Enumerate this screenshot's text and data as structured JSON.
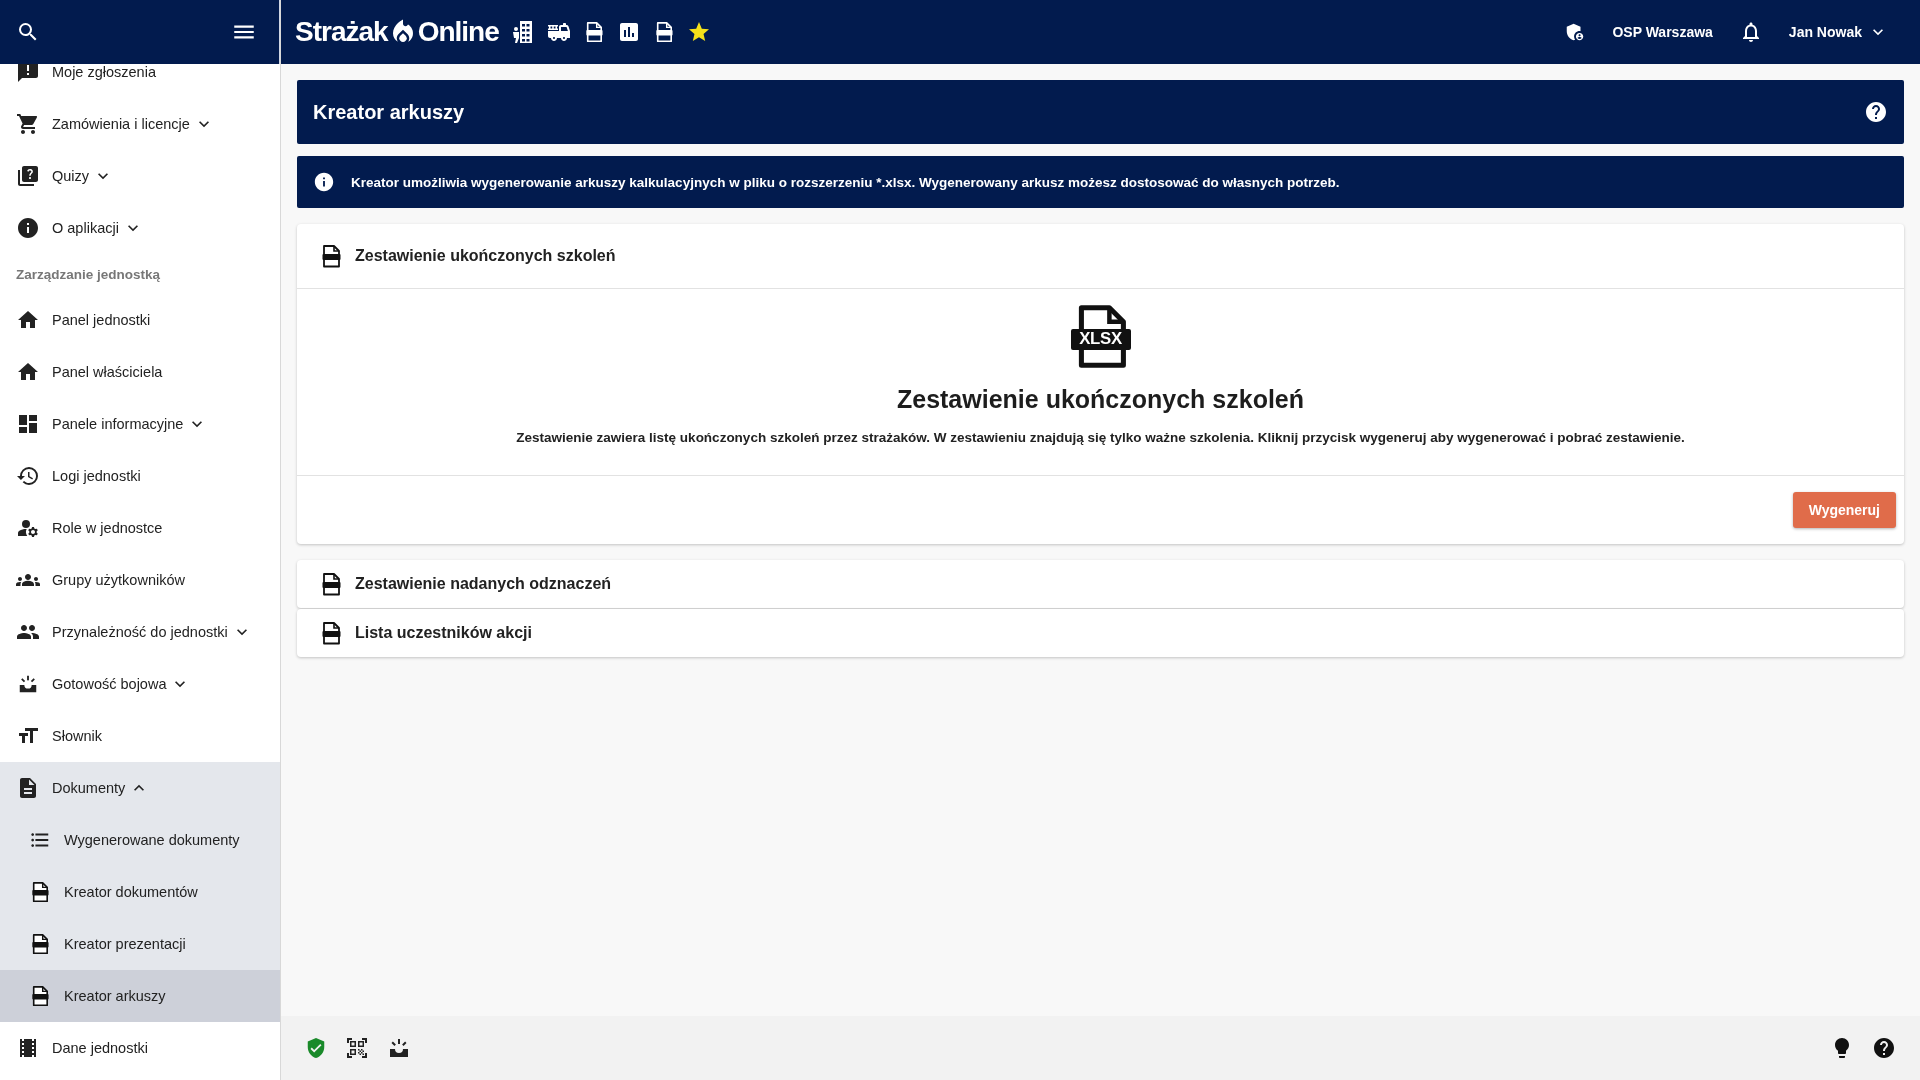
{
  "header": {
    "logo": [
      "Strażak",
      "Online"
    ],
    "unit": "OSP Warszawa",
    "user": "Jan Nowak"
  },
  "sidebar": {
    "items": [
      {
        "kind": "item",
        "label": "Moje zgłoszenia"
      },
      {
        "kind": "item",
        "label": "Zamówienia i licencje",
        "expanded": false
      },
      {
        "kind": "item",
        "label": "Quizy",
        "expanded": false
      },
      {
        "kind": "item",
        "label": "O aplikacji",
        "expanded": false
      },
      {
        "kind": "section",
        "label": "Zarządzanie jednostką"
      },
      {
        "kind": "item",
        "label": "Panel jednostki"
      },
      {
        "kind": "item",
        "label": "Panel właściciela"
      },
      {
        "kind": "item",
        "label": "Panele informacyjne",
        "expanded": false
      },
      {
        "kind": "item",
        "label": "Logi jednostki"
      },
      {
        "kind": "item",
        "label": "Role w jednostce"
      },
      {
        "kind": "item",
        "label": "Grupy użytkowników"
      },
      {
        "kind": "item",
        "label": "Przynależność do jednostki",
        "expanded": false
      },
      {
        "kind": "item",
        "label": "Gotowość bojowa",
        "expanded": false
      },
      {
        "kind": "item",
        "label": "Słownik"
      },
      {
        "kind": "item",
        "label": "Dokumenty",
        "expanded": true,
        "children": [
          {
            "label": "Wygenerowane dokumenty",
            "selected": false
          },
          {
            "label": "Kreator dokumentów",
            "kind": "file",
            "selected": false
          },
          {
            "label": "Kreator prezentacji",
            "kind": "file",
            "selected": false
          },
          {
            "label": "Kreator arkuszy",
            "kind": "file",
            "selected": true
          }
        ]
      },
      {
        "kind": "item",
        "label": "Dane jednostki"
      }
    ]
  },
  "page": {
    "title": "Kreator arkuszy",
    "info": "Kreator umożliwia wygenerowanie arkuszy kalkulacyjnych w pliku o rozszerzeniu *.xlsx. Wygenerowany arkusz możesz dostosować do własnych potrzeb.",
    "sheets": [
      {
        "title": "Zestawienie ukończonych szkoleń",
        "expanded": true,
        "big_file_label": "XLSX",
        "heading": "Zestawienie ukończonych szkoleń",
        "description": "Zestawienie zawiera listę ukończonych szkoleń przez strażaków. W zestawieniu znajdują się tylko ważne szkolenia. Kliknij przycisk wygeneruj aby wygenerować i pobrać zestawienie.",
        "button": "Wygeneruj"
      },
      {
        "title": "Zestawienie nadanych odznaczeń",
        "expanded": false
      },
      {
        "title": "Lista uczestników akcji",
        "expanded": false
      }
    ]
  }
}
